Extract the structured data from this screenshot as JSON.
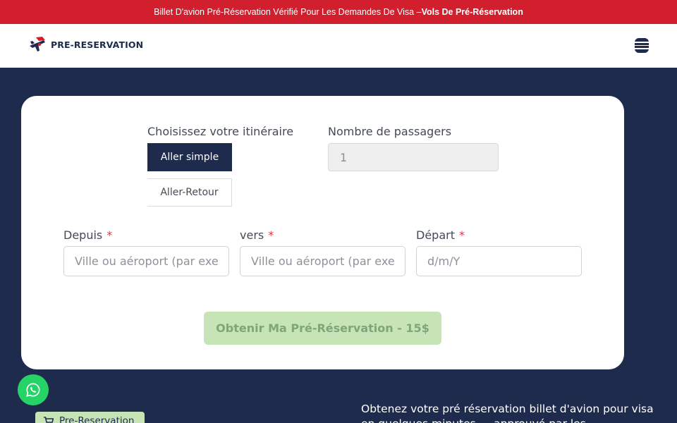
{
  "topbar": {
    "text": "Billet D'avion Pré-Réservation Vérifié Pour Les Demandes De Visa – ",
    "link": "Vols De Pré-Réservation"
  },
  "header": {
    "logo_text": "PRE-RESERVATION",
    "menu_icon": "hamburger-icon"
  },
  "form": {
    "itinerary_label": "Choisissez votre itinéraire",
    "one_way_label": "Aller simple",
    "round_trip_label": "Aller-Retour",
    "passengers_label": "Nombre de passagers",
    "passengers_value": "1",
    "from_label": "Depuis",
    "from_placeholder": "Ville ou aéroport (par exemple",
    "to_label": "vers",
    "to_placeholder": "Ville ou aéroport (par exemple",
    "departure_label": "Départ",
    "departure_placeholder": "d/m/Y",
    "required_mark": "*",
    "submit_label": "Obtenir Ma Pré-Réservation - 15$"
  },
  "footer": {
    "badge_label": "Pre-Reservation",
    "intro_text": "Obtenez votre pré réservation billet d'avion pour visa en quelques minutes — approuvé par les"
  },
  "colors": {
    "navy": "#1f2b4d",
    "red": "#d21f2e",
    "green": "#25d366",
    "light_green": "#c6e4b6"
  }
}
